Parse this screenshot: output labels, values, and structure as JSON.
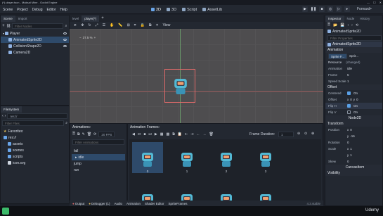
{
  "titlebar": {
    "title": "(*) player.tscn - Maksai Mine - Godot Engine",
    "controls": [
      "—",
      "☐",
      "✕"
    ]
  },
  "menubar": {
    "menus": [
      "Scene",
      "Project",
      "Debug",
      "Editor",
      "Help"
    ],
    "workspaces": [
      {
        "icon": "2d-icon",
        "label": "2D"
      },
      {
        "icon": "3d-icon",
        "label": "3D"
      },
      {
        "icon": "script-icon",
        "label": "Script"
      },
      {
        "icon": "assetlib-icon",
        "label": "AssetLib"
      }
    ],
    "renderer": "Forward+"
  },
  "scene_dock": {
    "tabs": [
      "Scene",
      "Import"
    ],
    "filter_placeholder": "Filter Nodes",
    "nodes": [
      {
        "label": "Player",
        "depth": 0
      },
      {
        "label": "AnimatedSprite2D",
        "depth": 1
      },
      {
        "label": "CollisionShape2D",
        "depth": 1
      },
      {
        "label": "Camera2D",
        "depth": 1
      }
    ]
  },
  "filesystem": {
    "tab": "FileSystem",
    "path": "res://",
    "filter_placeholder": "Filter Files",
    "items": [
      {
        "label": "Favorites:",
        "depth": 0
      },
      {
        "label": "res://",
        "depth": 0
      },
      {
        "label": "assets",
        "depth": 1
      },
      {
        "label": "scenes",
        "depth": 1
      },
      {
        "label": "scripts",
        "depth": 1
      },
      {
        "label": "icon.svg",
        "depth": 1
      }
    ]
  },
  "editor_tabs": [
    "level",
    "player(*)"
  ],
  "toolbar": {
    "view_label": "View"
  },
  "viewport": {
    "zoom": "37.5 %"
  },
  "animations": {
    "title": "Animations:",
    "fps": "20 FPS",
    "filter_placeholder": "Filter Animations",
    "list": [
      "fall",
      "idle",
      "jump",
      "run"
    ],
    "selected": "idle"
  },
  "frames": {
    "title": "Animation Frames:",
    "duration_label": "Frame Duration:",
    "duration_value": "1",
    "labels": [
      "0",
      "1",
      "2",
      "3"
    ]
  },
  "bottom_bar": {
    "items": [
      "Output",
      "Debugger (1)",
      "Audio",
      "Animation",
      "Shader Editor",
      "SpriteFrames"
    ],
    "version": "4.3.stable"
  },
  "inspector": {
    "tabs": [
      "Inspector",
      "Node",
      "History"
    ],
    "node_name": "AnimatedSprite2D",
    "filter_placeholder": "Filter Properties",
    "sections": {
      "animation": "Animation",
      "offset": "Offset",
      "node2d": "Node2D",
      "transform": "Transform",
      "canvasitem": "CanvasItem",
      "visibility": "Visibility"
    },
    "props": {
      "sprite_frames": "Sprite F...",
      "sprite_frames2": "Sprit...",
      "resource": "Resource",
      "resource_tag": "(changed)",
      "animation_label": "Animation",
      "animation_value": "idle",
      "frame_label": "Frame",
      "frame_value": "5",
      "speed_label": "Speed Scale",
      "speed_value": "1",
      "centered_label": "Centered",
      "centered_value": "On",
      "offset_label": "Offset",
      "offset_x": "0",
      "offset_y": "0",
      "fliph_label": "Flip H",
      "fliph_value": "On",
      "flipv_label": "Flip V",
      "flipv_value": "On",
      "position_label": "Position",
      "pos_x": "0",
      "pos_y": "-16",
      "rotation_label": "Rotation",
      "rotation_value": "0",
      "scale_label": "Scale",
      "scale_x": "1",
      "scale_y": "1",
      "skew_label": "Skew",
      "skew_value": "0"
    }
  },
  "watermark": "Udemy",
  "colors": {
    "accent": "#5aa0e6",
    "selection": "#2e4a6a",
    "viewport": "#4e4d4f"
  }
}
